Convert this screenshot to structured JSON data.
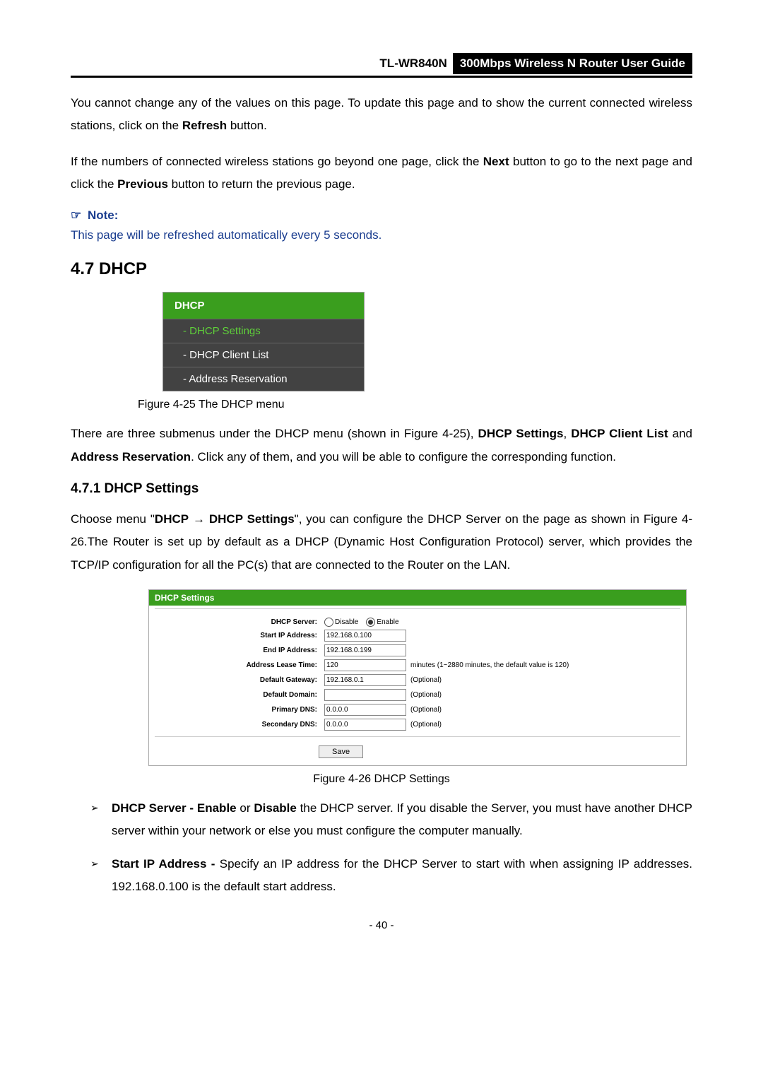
{
  "header": {
    "model": "TL-WR840N",
    "guide": "300Mbps Wireless N Router User Guide"
  },
  "p1_a": "You cannot change any of the values on this page. To update this page and to show the current connected wireless stations, click on the ",
  "p1_b": "Refresh",
  "p1_c": " button.",
  "p2_a": "If the numbers of connected wireless stations go beyond one page, click the ",
  "p2_b": "Next",
  "p2_c": " button to go to the next page and click the ",
  "p2_d": "Previous",
  "p2_e": " button to return the previous page.",
  "note_pointer": "☞",
  "note_label": "Note:",
  "note_body": "This page will be refreshed automatically every 5 seconds.",
  "section_heading": "4.7  DHCP",
  "menu": {
    "title": "DHCP",
    "items": [
      "- DHCP Settings",
      "- DHCP Client List",
      "- Address Reservation"
    ]
  },
  "fig25": "Figure 4-25    The DHCP menu",
  "p3_a": "There are three submenus under the DHCP menu (shown in Figure 4-25), ",
  "p3_b": "DHCP Settings",
  "p3_c": ", ",
  "p3_d": "DHCP Client List",
  "p3_e": " and ",
  "p3_f": "Address Reservation",
  "p3_g": ". Click any of them, and you will be able to configure the corresponding function.",
  "sub_heading": "4.7.1  DHCP Settings",
  "p4_a": "Choose menu \"",
  "p4_b": "DHCP",
  "p4_c": "  →  ",
  "p4_d": "DHCP Settings",
  "p4_e": "\", you can configure the DHCP Server on the page as shown in Figure 4-26.The Router is set up by default as a DHCP (Dynamic Host Configuration Protocol) server, which provides the TCP/IP configuration for all the PC(s) that are connected to the Router on the LAN.",
  "settings": {
    "title": "DHCP Settings",
    "rows": {
      "server": {
        "label": "DHCP Server:",
        "opt_disable": "Disable",
        "opt_enable": "Enable"
      },
      "start": {
        "label": "Start IP Address:",
        "value": "192.168.0.100"
      },
      "end": {
        "label": "End IP Address:",
        "value": "192.168.0.199"
      },
      "lease": {
        "label": "Address Lease Time:",
        "value": "120",
        "hint": "minutes (1~2880 minutes, the default value is 120)"
      },
      "gateway": {
        "label": "Default Gateway:",
        "value": "192.168.0.1",
        "hint": "(Optional)"
      },
      "domain": {
        "label": "Default Domain:",
        "value": "",
        "hint": "(Optional)"
      },
      "pdns": {
        "label": "Primary DNS:",
        "value": "0.0.0.0",
        "hint": "(Optional)"
      },
      "sdns": {
        "label": "Secondary DNS:",
        "value": "0.0.0.0",
        "hint": "(Optional)"
      }
    },
    "save": "Save"
  },
  "fig26": "Figure 4-26 DHCP Settings",
  "bullets": {
    "b1_a": "DHCP Server - Enable",
    "b1_b": " or ",
    "b1_c": "Disable",
    "b1_d": " the DHCP server. If you disable the Server, you must have another DHCP server within your network or else you must configure the computer manually.",
    "b2_a": "Start IP Address -",
    "b2_b": " Specify an IP address for the DHCP Server to start with when assigning IP addresses. 192.168.0.100 is the default start address."
  },
  "page_number": "- 40 -"
}
